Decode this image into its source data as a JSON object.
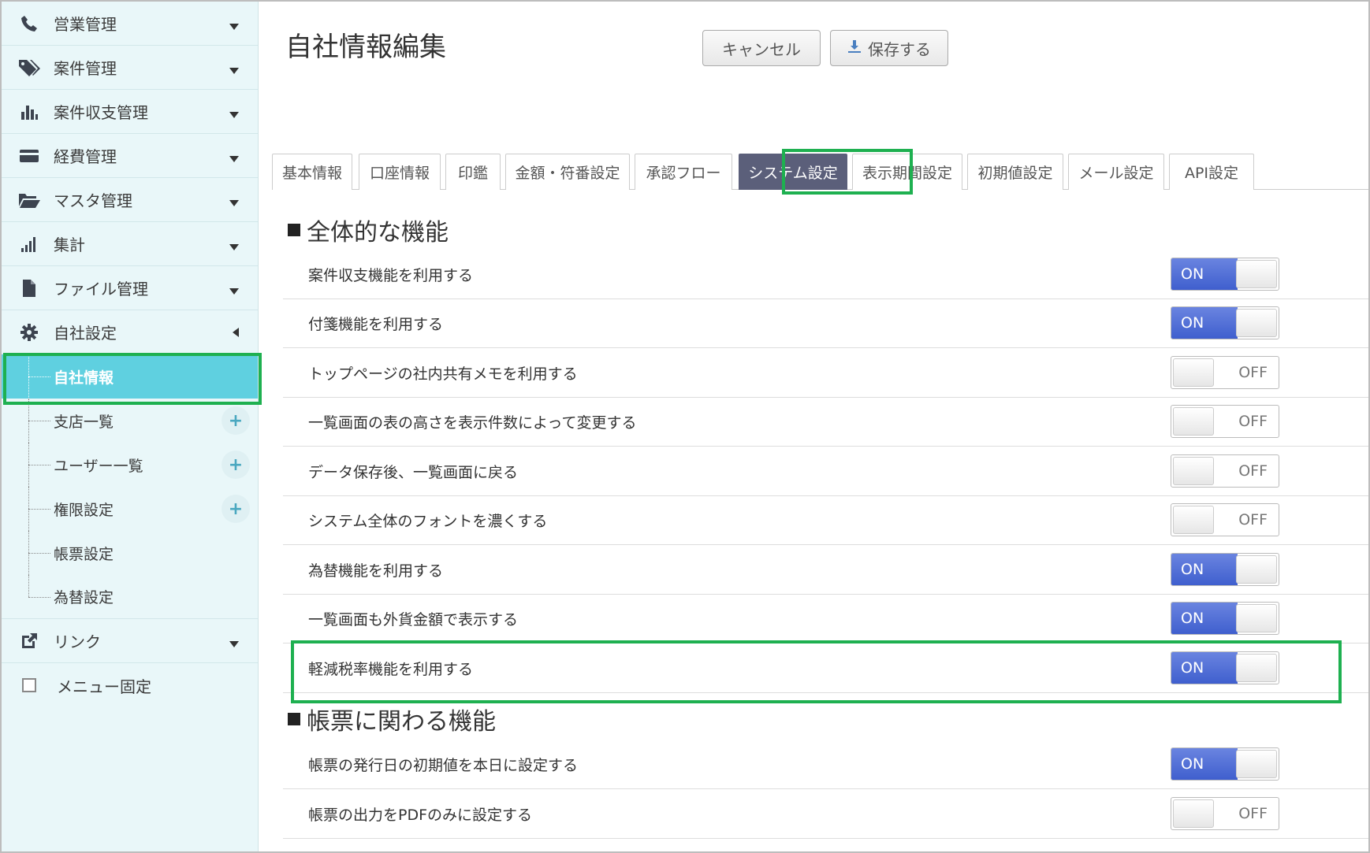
{
  "sidebar": {
    "items": [
      {
        "label": "営業管理",
        "icon": "phone-icon"
      },
      {
        "label": "案件管理",
        "icon": "tags-icon"
      },
      {
        "label": "案件収支管理",
        "icon": "bar-chart-icon"
      },
      {
        "label": "経費管理",
        "icon": "credit-card-icon"
      },
      {
        "label": "マスタ管理",
        "icon": "folder-open-icon"
      },
      {
        "label": "集計",
        "icon": "signal-icon"
      },
      {
        "label": "ファイル管理",
        "icon": "file-icon"
      },
      {
        "label": "自社設定",
        "icon": "gear-icon"
      }
    ],
    "sub_items": [
      {
        "label": "自社情報",
        "active": true
      },
      {
        "label": "支店一覧",
        "plus": true
      },
      {
        "label": "ユーザー一覧",
        "plus": true
      },
      {
        "label": "権限設定",
        "plus": true
      },
      {
        "label": "帳票設定"
      },
      {
        "label": "為替設定"
      }
    ],
    "link": {
      "label": "リンク",
      "icon": "external-link-icon"
    },
    "pin_menu": {
      "label": "メニュー固定",
      "checked": false
    },
    "plus_symbol": "+"
  },
  "main": {
    "title": "自社情報編集",
    "cancel_label": "キャンセル",
    "save_label": "保存する",
    "tabs": [
      {
        "label": "基本情報"
      },
      {
        "label": "口座情報"
      },
      {
        "label": "印鑑"
      },
      {
        "label": "金額・符番設定"
      },
      {
        "label": "承認フロー"
      },
      {
        "label": "システム設定",
        "active": true
      },
      {
        "label": "表示期間設定"
      },
      {
        "label": "初期値設定"
      },
      {
        "label": "メール設定"
      },
      {
        "label": "API設定"
      }
    ],
    "sections": [
      {
        "title": "全体的な機能",
        "settings": [
          {
            "label": "案件収支機能を利用する",
            "state": "ON"
          },
          {
            "label": "付箋機能を利用する",
            "state": "ON"
          },
          {
            "label": "トップページの社内共有メモを利用する",
            "state": "OFF"
          },
          {
            "label": "一覧画面の表の高さを表示件数によって変更する",
            "state": "OFF"
          },
          {
            "label": "データ保存後、一覧画面に戻る",
            "state": "OFF"
          },
          {
            "label": "システム全体のフォントを濃くする",
            "state": "OFF"
          },
          {
            "label": "為替機能を利用する",
            "state": "ON"
          },
          {
            "label": "一覧画面も外貨金額で表示する",
            "state": "ON"
          },
          {
            "label": "軽減税率機能を利用する",
            "state": "ON"
          }
        ]
      },
      {
        "title": "帳票に関わる機能",
        "settings": [
          {
            "label": "帳票の発行日の初期値を本日に設定する",
            "state": "ON"
          },
          {
            "label": "帳票の出力をPDFのみに設定する",
            "state": "OFF"
          }
        ]
      }
    ],
    "toggle_on_text": "ON",
    "toggle_off_text": "OFF"
  },
  "colors": {
    "sidebar_bg": "#e9f7f9",
    "active_sub_bg": "#5fd0e0",
    "active_tab_bg": "#5b5f7a",
    "toggle_on": "#4a6ad4",
    "highlight": "#1eb050"
  }
}
